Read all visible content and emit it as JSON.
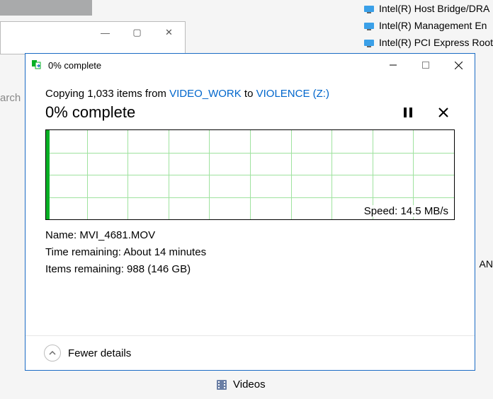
{
  "bg_tree": {
    "items": [
      "Intel(R) Host Bridge/DRA",
      "Intel(R) Management En",
      "Intel(R) PCI Express Root"
    ]
  },
  "bg_window": {
    "min": "—",
    "max": "▢",
    "close": "✕"
  },
  "bg_arch": "arch",
  "bg_videos": "Videos",
  "side_txt": "AN",
  "dialog": {
    "title": "0% complete",
    "copy_prefix": "Copying 1,033 items from ",
    "source": "VIDEO_WORK",
    "to": " to ",
    "dest": "VIOLENCE (Z:)",
    "percent": "0% complete",
    "speed_label": "Speed: 14.5 MB/s",
    "name_label": "Name:  ",
    "name_value": "MVI_4681.MOV",
    "time_label": "Time remaining:  ",
    "time_value": "About 14 minutes",
    "items_label": "Items remaining:  ",
    "items_value": "988 (146 GB)",
    "fewer": "Fewer details"
  }
}
